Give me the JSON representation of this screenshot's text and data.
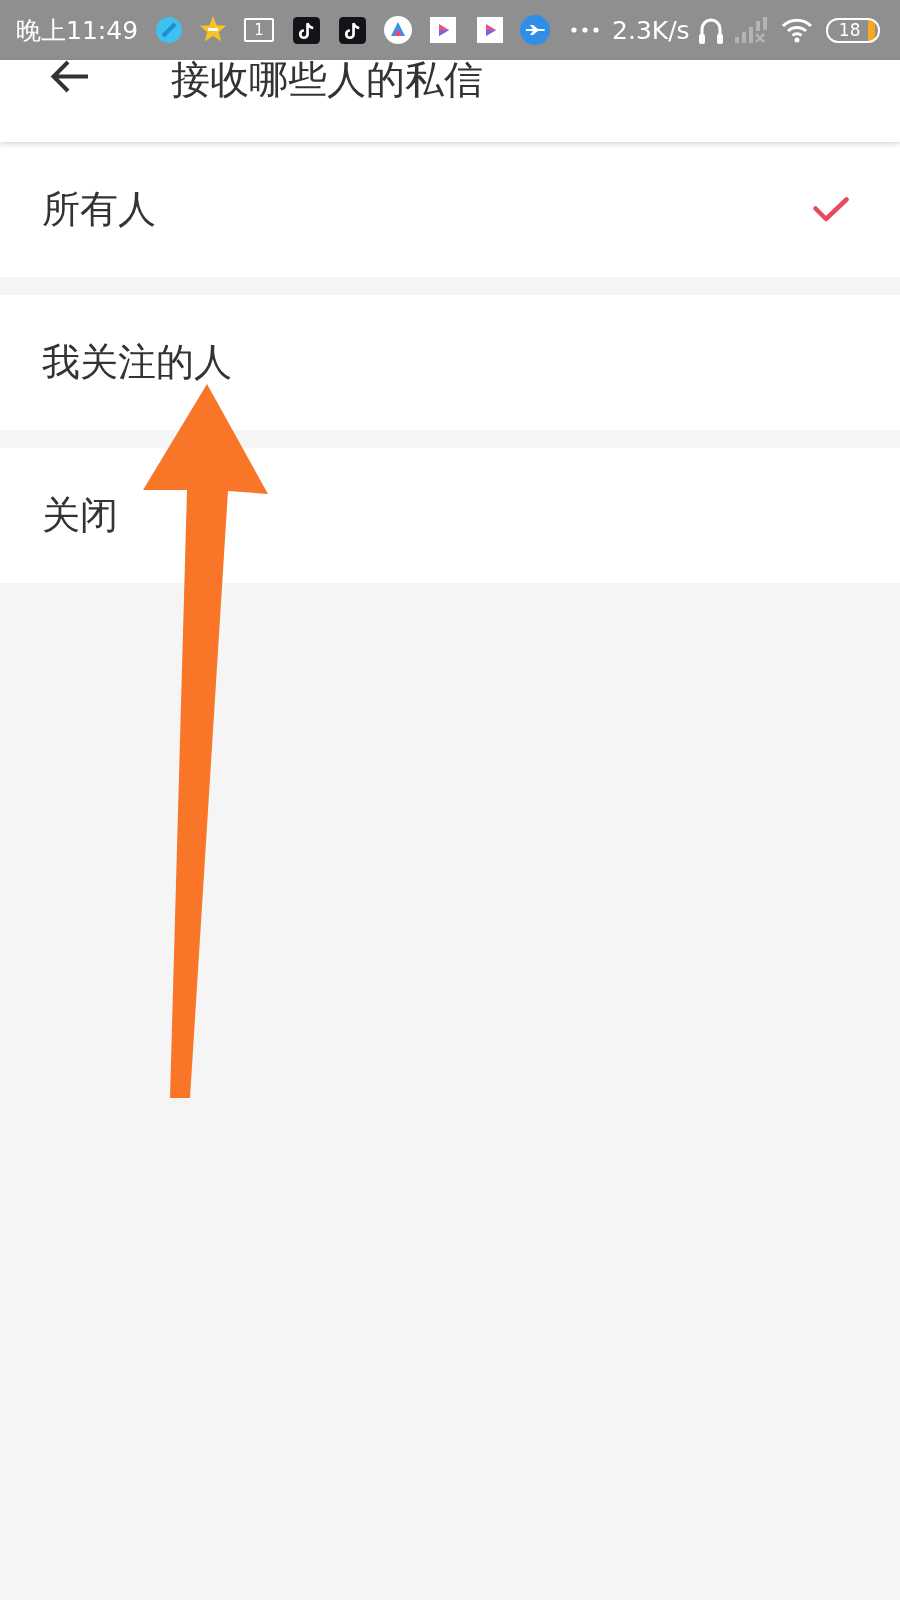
{
  "status_bar": {
    "time": "晚上11:49",
    "notification_count": "1",
    "network_speed": "2.3K/s",
    "battery": "18"
  },
  "header": {
    "title": "接收哪些人的私信"
  },
  "options": [
    {
      "label": "所有人",
      "selected": true
    },
    {
      "label": "我关注的人",
      "selected": false
    },
    {
      "label": "关闭",
      "selected": false
    }
  ],
  "annotation": {
    "kind": "arrow"
  }
}
